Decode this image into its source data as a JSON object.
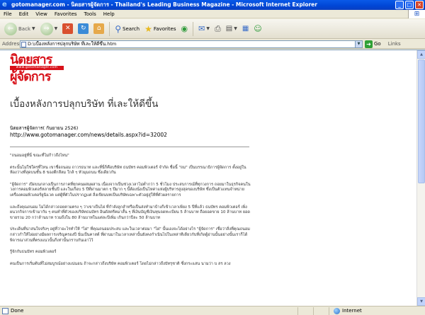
{
  "window": {
    "title": "gotomanager.com - นิตยสารผู้จัดการ - Thailand's Leading Business Magazine - Microsoft Internet Explorer"
  },
  "menu": {
    "items": [
      "File",
      "Edit",
      "View",
      "Favorites",
      "Tools",
      "Help"
    ]
  },
  "toolbar": {
    "back_label": "Back",
    "search_label": "Search",
    "favorites_label": "Favorites"
  },
  "address": {
    "label": "Address",
    "value": "D:\\เบื้องหลังการปลุกบริษัท ที่เละให้ดีขึ้น.htm",
    "go_label": "Go",
    "links_label": "Links"
  },
  "page": {
    "logo_top": "นิตยสาร",
    "logo_mid": "www.gotomanager.com",
    "logo_bottom": "ผู้จัดการ",
    "headline": "เบื้องหลังการปลุกบริษัท ที่เละให้ดีขึ้น",
    "source": "นิตยสารผู้จัดการ( กันยายน 2526)",
    "url": "http://www.gotomanager.com/news/details.aspx?id=32002",
    "paragraphs": [
      "\"ถนอมอยู่ที่นี่ ขณะที่ไม่ก้าวถึงไหน\"",
      "ตระนั้นไม่ใช่ใครที่ไหน เขาชื่อถนอม ถาวรธนาท และที่นี่ก็คือบริษัท ธนบัทร คอมพิวเตอร์ จำกัด ชื่อนี้ \"ถม\" เป็นบรรณาธิการผู้จัดการ ตั้งอยู่ในห้องว่างที่สุดบนชั้น 8 ของตึกสีลม ใกล้ ๆ หัวมุมถนน ซึ่งเดียวกัน",
      "\"ผู้จัดการ\" เปิดบนกลางเป็นการภาคที่ทุกคนผสมผสาน เนื่องจากเป็นช่วงเวลาไม่ต่ำกว่า 5 ชั่วโมง ประสบการณ์ที่ทุกวงการ ถอยมาในธุรกิจคนในวงการคอมพิวเตอร์หลายชั้นปี และในเกือบ 5 ปีที่ผ่านมาตก ๆ ปีมาก ๆ นี้ต้องนั่งเป็นไหค่าแห่งผู้บริหารสูงสุดของบริษัท ซึ่งเป็นตัวแทนจำหน่ายเครื่องคอมพิวเตอร์ยูนิแวค แต่ผู้ที่ตัวในปรากฏแต่ สิ่งเขียนบทเป็นบริษัทเฉพาะตัวอยู่สู่ให้ที่ตัวผลรายการ",
      "และถึงคุณถนอม ไม่ได้กล่าวถอยตามตรง ๆ ว่าเขาเป็นไผ่ ที่กำลังลูกลำหรือเป็นส่งทำมาบ้างก็เข้าเวลาเพียง 5 ปีที่แล้ว ธนบัทร คอมพิวเตอร์ เพิ่งผนวกกิจการเข้ามากับ ๆ คนทำที่ตัวของบริษัทธนบัทร อินดัสตรีคมาสั้น ๆ ที่เงินบัญชีเงินทุนจดทะเบียน 5 ล้านบาท ถือยอดขาย 10 ล้านบาท ยอดขายรวม 20 กว่าล้านบาท รวมถึงใน 80 ล้านบาทในแต่ละปีเพิ่ม เกินกว่าปีละ 50 ล้านบาท",
      "ประเด็นที่น่าสนใจจริงๆ อยู่ที่ว่าอะไรทำให้ \"ไผ่\" ที่คุณถนอมประสบ และในเวลาต่อมา \"ไผ่\" นั้นเองจะได้อย่างไร \"ผู้จัดการ\" เชื่อว่าสิ่งที่คุณถนอมกล่าวกำให้ไผ่อย่างมีผลการเจริญครองปี นั่นเป็นคาสต์ ที่ผ่านมาในเวลาเหล่านั้นยังคงกำเนินไปในเหล่าทีเดียวกับที่เกิดผู้อ่านนั้นอย่างนั้นเราก็ได้พิจารณาส่วนที่ตรงแนวนั้นก็เท่านั้นกราบกันเอาไว้",
      "รู้จักกับธนบัทร คอมพิวเตอร์",
      "คนเป็นการเริ่มต้นที่ไม่สมบูรณ์อย่างแน่นอน ถ้าจะกล่าวถึงบริษัท คอมพิวเตอร์ โดยไม่กล่าวถึงบัทรุชาติ ซึ่งกระแสน นามว่า บ สร ลวง"
    ]
  },
  "status": {
    "left": "Done",
    "zone": "Internet"
  }
}
